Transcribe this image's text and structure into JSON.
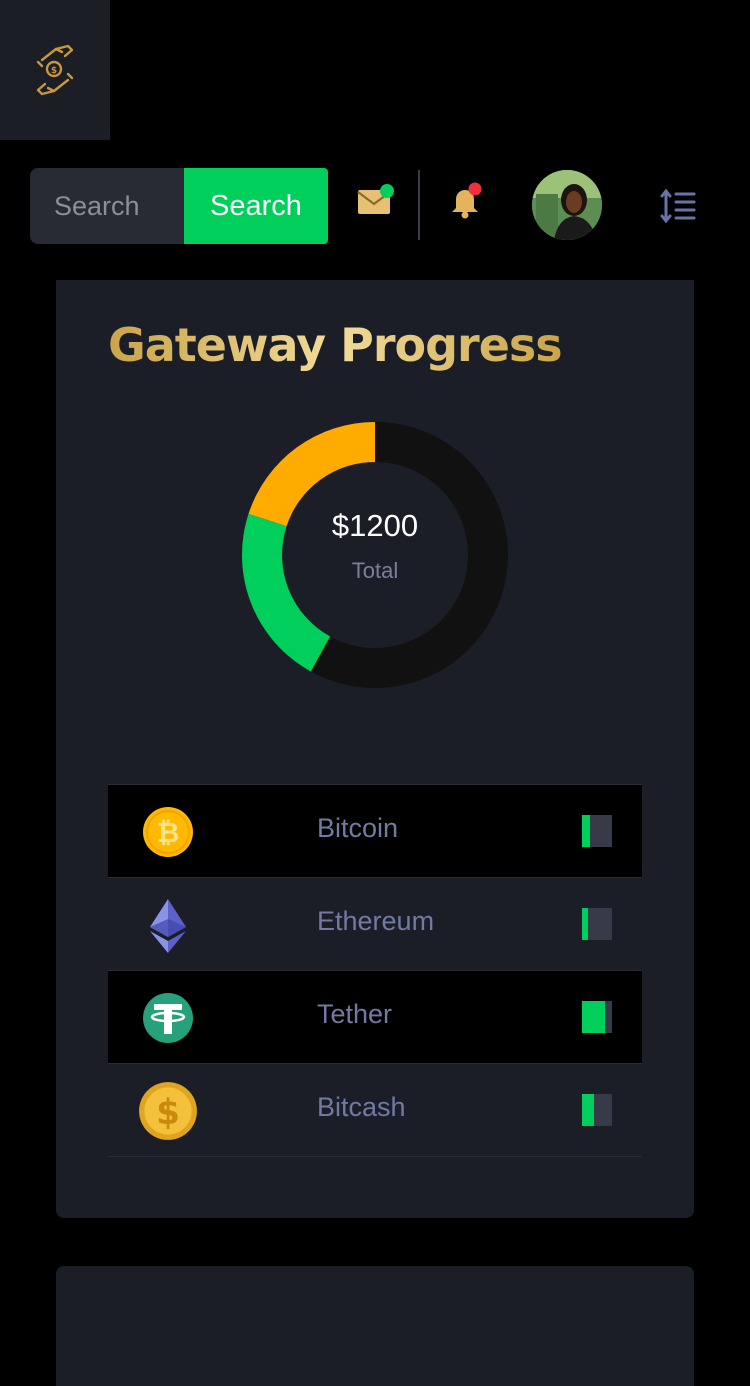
{
  "header": {
    "logo_icon": "hands-coin-icon",
    "search": {
      "placeholder": "Search",
      "button_label": "Search"
    },
    "icons": {
      "mail": "mail-icon",
      "mail_badge_color": "#00cf5c",
      "bell": "bell-icon",
      "bell_badge_color": "#f0313a",
      "menu": "sort-lines-icon"
    }
  },
  "gateway": {
    "title": "Gateway Progress",
    "total": "$1200",
    "total_label": "Total",
    "chart_data": {
      "type": "pie",
      "values": [
        20,
        22,
        58
      ],
      "colors": [
        "#ffab00",
        "#00cf5c",
        "#111111"
      ]
    },
    "coins": [
      {
        "name": "Bitcoin",
        "icon": "bitcoin-icon",
        "progress": 0.25
      },
      {
        "name": "Ethereum",
        "icon": "ethereum-icon",
        "progress": 0.2
      },
      {
        "name": "Tether",
        "icon": "tether-icon",
        "progress": 0.75
      },
      {
        "name": "Bitcash",
        "icon": "bitcash-dollar-icon",
        "progress": 0.4
      }
    ]
  },
  "colors": {
    "accent": "#00cf5c",
    "gold": "#d9b45c",
    "card": "#1b1e27"
  }
}
